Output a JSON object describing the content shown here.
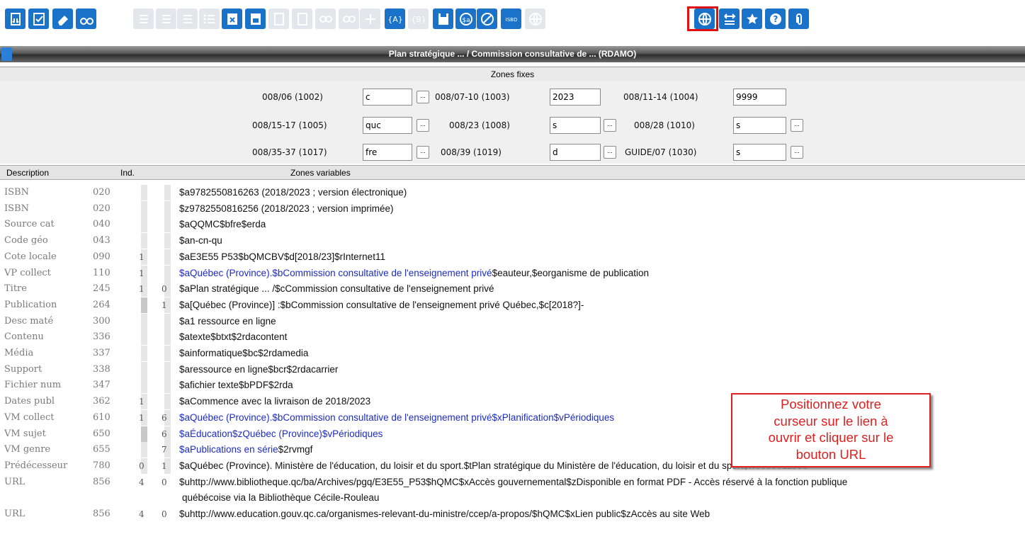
{
  "title": "Plan stratégique ... / Commission consultative de ... (RDAMO)",
  "fixed_zones": {
    "header": "Zones fixes",
    "fields": [
      {
        "label": "008/06 (1002)",
        "value": "c"
      },
      {
        "label": "008/07-10 (1003)",
        "value": "2023"
      },
      {
        "label": "008/11-14 (1004)",
        "value": "9999"
      },
      {
        "label": "008/15-17 (1005)",
        "value": "quc"
      },
      {
        "label": "008/23 (1008)",
        "value": "s"
      },
      {
        "label": "008/28 (1010)",
        "value": "s"
      },
      {
        "label": "008/35-37 (1017)",
        "value": "fre"
      },
      {
        "label": "008/39 (1019)",
        "value": "d"
      },
      {
        "label": "GUIDE/07 (1030)",
        "value": "s"
      }
    ],
    "browse_label": "..."
  },
  "columns": {
    "description": "Description",
    "ind": "Ind.",
    "variable": "Zones variables"
  },
  "rows": [
    {
      "desc": "ISBN",
      "tag": "020",
      "ind1": "",
      "ind2": "",
      "parts": [
        {
          "text": "$a9782550816263 (2018/2023 ; version électronique)",
          "link": false
        }
      ]
    },
    {
      "desc": "ISBN",
      "tag": "020",
      "ind1": "",
      "ind2": "",
      "parts": [
        {
          "text": "$z9782550816256 (2018/2023 ; version imprimée)",
          "link": false
        }
      ]
    },
    {
      "desc": "Source cat",
      "tag": "040",
      "ind1": "",
      "ind2": "",
      "parts": [
        {
          "text": "$aQQMC$bfre$erda",
          "link": false
        }
      ]
    },
    {
      "desc": "Code géo",
      "tag": "043",
      "ind1": "",
      "ind2": "",
      "parts": [
        {
          "text": "$an-cn-qu",
          "link": false
        }
      ]
    },
    {
      "desc": "Cote locale",
      "tag": "090",
      "ind1": "1",
      "ind2": "",
      "parts": [
        {
          "text": "$aE3E55 P53$bQMCBV$d[2018/23]$rInternet11",
          "link": false
        }
      ]
    },
    {
      "desc": "VP collect",
      "tag": "110",
      "ind1": "1",
      "ind2": "",
      "parts": [
        {
          "text": "$aQuébec (Province).$bCommission consultative de l'enseignement privé",
          "link": true
        },
        {
          "text": "$eauteur,$eorganisme de publication",
          "link": false
        }
      ]
    },
    {
      "desc": "Titre",
      "tag": "245",
      "ind1": "1",
      "ind2": "0",
      "parts": [
        {
          "text": "$aPlan stratégique ... /$cCommission consultative de l'enseignement privé",
          "link": false
        }
      ]
    },
    {
      "desc": "Publication",
      "tag": "264",
      "ind1": "",
      "ind2": "1",
      "parts": [
        {
          "text": "$a[Québec (Province)] :$bCommission consultative de l'enseignement privé Québec,$c[2018?]-",
          "link": false
        }
      ]
    },
    {
      "desc": "Desc maté",
      "tag": "300",
      "ind1": "",
      "ind2": "",
      "parts": [
        {
          "text": "$a1 ressource en ligne",
          "link": false
        }
      ]
    },
    {
      "desc": "Contenu",
      "tag": "336",
      "ind1": "",
      "ind2": "",
      "parts": [
        {
          "text": "$atexte$btxt$2rdacontent",
          "link": false
        }
      ]
    },
    {
      "desc": "Média",
      "tag": "337",
      "ind1": "",
      "ind2": "",
      "parts": [
        {
          "text": "$ainformatique$bc$2rdamedia",
          "link": false
        }
      ]
    },
    {
      "desc": "Support",
      "tag": "338",
      "ind1": "",
      "ind2": "",
      "parts": [
        {
          "text": "$aressource en ligne$bcr$2rdacarrier",
          "link": false
        }
      ]
    },
    {
      "desc": "Fichier num",
      "tag": "347",
      "ind1": "",
      "ind2": "",
      "parts": [
        {
          "text": "$afichier texte$bPDF$2rda",
          "link": false
        }
      ]
    },
    {
      "desc": "Dates publ",
      "tag": "362",
      "ind1": "1",
      "ind2": "",
      "parts": [
        {
          "text": "$aCommence avec la livraison de 2018/2023",
          "link": false
        }
      ]
    },
    {
      "desc": "VM collect",
      "tag": "610",
      "ind1": "1",
      "ind2": "6",
      "parts": [
        {
          "text": "$aQuébec (Province).$bCommission consultative de l'enseignement privé$xPlanification$vPériodiques",
          "link": true
        }
      ]
    },
    {
      "desc": "VM sujet",
      "tag": "650",
      "ind1": "",
      "ind2": "6",
      "parts": [
        {
          "text": "$aÉducation$zQuébec (Province)$vPériodiques",
          "link": true
        }
      ]
    },
    {
      "desc": "VM genre",
      "tag": "655",
      "ind1": "",
      "ind2": "7",
      "parts": [
        {
          "text": "$aPublications en série",
          "link": true
        },
        {
          "text": "$2rvmgf",
          "link": false
        }
      ]
    },
    {
      "desc": "Prédécesseur",
      "tag": "780",
      "ind1": "0",
      "ind2": "1",
      "parts": [
        {
          "text": "$aQuébec (Province). Ministère de l'éducation, du loisir et du sport.$tPlan stratégique du Ministère de l'éducation, du loisir et du sport$w0000811555",
          "link": false
        }
      ]
    },
    {
      "desc": "URL",
      "tag": "856",
      "ind1": "4",
      "ind2": "0",
      "parts": [
        {
          "text": "$uhttp://www.bibliotheque.qc/ba/Archives/pgq/E3E55_P53$hQMC$xAccès gouvernemental$zDisponible en format PDF - Accès réservé à la fonction publique",
          "link": false
        }
      ]
    },
    {
      "desc": "",
      "tag": "",
      "ind1": "",
      "ind2": "",
      "parts": [
        {
          "text": "québécoise via la Bibliothèque Cécile-Rouleau",
          "link": false
        }
      ]
    },
    {
      "desc": "URL",
      "tag": "856",
      "ind1": "4",
      "ind2": "0",
      "parts": [
        {
          "text": "$uhttp://www.education.gouv.qc.ca/organismes-relevant-du-ministre/ccep/a-propos/$hQMC$xLien public$zAccès au site Web",
          "link": false
        }
      ]
    }
  ],
  "callout": {
    "lines": [
      "Positionnez votre",
      "curseur sur le lien à",
      "ouvrir et cliquer sur le",
      "bouton URL"
    ]
  },
  "toolbar": {
    "isbd_label": "ISBD",
    "sa_label": "$a",
    "url_label": "URL",
    "buttons": [
      {
        "name": "import-icon",
        "enabled": true
      },
      {
        "name": "validate-icon",
        "enabled": true
      },
      {
        "name": "eraser-icon",
        "enabled": true
      },
      {
        "name": "binoculars-icon",
        "enabled": true
      },
      {
        "name": "list-icon",
        "enabled": false
      },
      {
        "name": "list-icon",
        "enabled": false
      },
      {
        "name": "list-icon",
        "enabled": false
      },
      {
        "name": "bullet-list-icon",
        "enabled": false
      },
      {
        "name": "delete-field-icon",
        "enabled": true
      },
      {
        "name": "insert-field-icon",
        "enabled": true
      },
      {
        "name": "field-icon",
        "enabled": false
      },
      {
        "name": "field-icon",
        "enabled": false
      },
      {
        "name": "link-icon",
        "enabled": false
      },
      {
        "name": "link-icon",
        "enabled": false
      },
      {
        "name": "add-icon",
        "enabled": false
      },
      {
        "name": "subfield-icon",
        "enabled": true
      },
      {
        "name": "subfield-b-icon",
        "enabled": false
      },
      {
        "name": "save-icon",
        "enabled": true
      },
      {
        "name": "subfield-a-icon",
        "enabled": true
      },
      {
        "name": "no-subfield-icon",
        "enabled": true
      },
      {
        "name": "isbd-icon",
        "enabled": true
      },
      {
        "name": "globe-icon",
        "enabled": false
      },
      {
        "name": "url-globe-icon",
        "enabled": true
      },
      {
        "name": "swap-icon",
        "enabled": true
      },
      {
        "name": "star-icon",
        "enabled": true
      },
      {
        "name": "help-icon",
        "enabled": true
      },
      {
        "name": "paperclip-icon",
        "enabled": true
      }
    ],
    "colors": {
      "enabled": "#1a73c9",
      "disabled": "#e3e6ea",
      "link": "#1d2bc6",
      "callout": "#e02020"
    }
  }
}
